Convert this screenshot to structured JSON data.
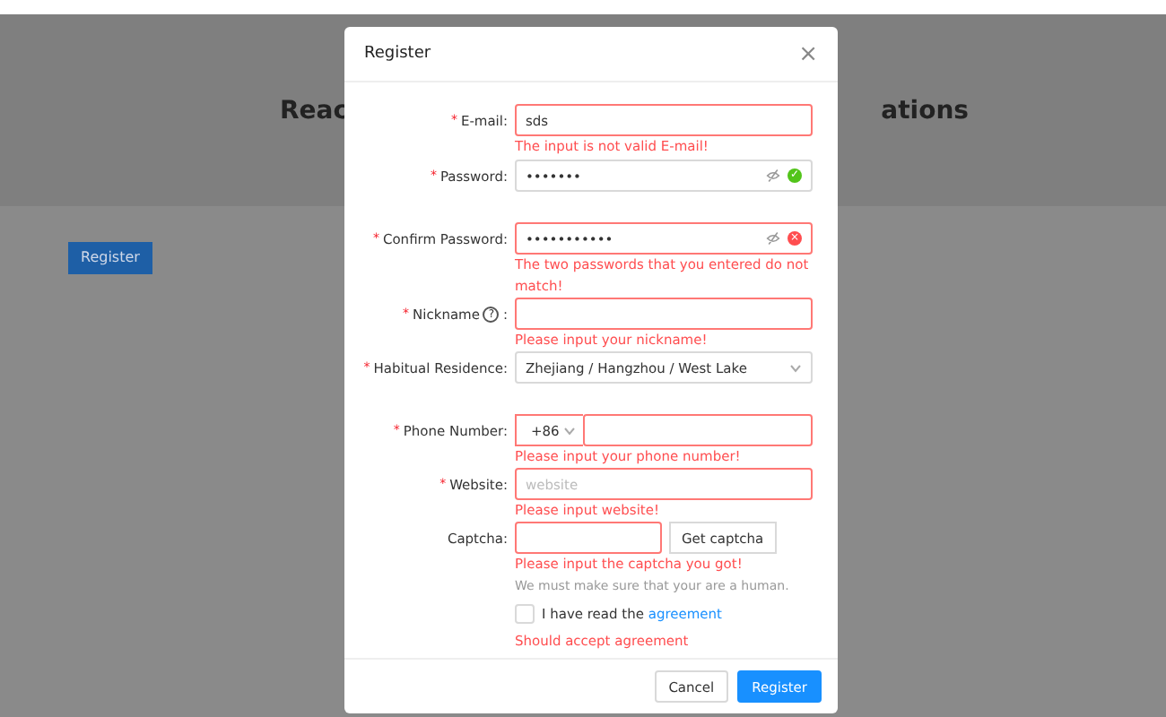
{
  "page": {
    "title_left": "Reac",
    "title_right": "ations",
    "register_button": "Register"
  },
  "modal": {
    "title": "Register",
    "close": "×",
    "fields": [
      {
        "kind": "text",
        "label": "E-mail:",
        "required_mark": "*",
        "value": "sds",
        "error": "The input is not valid E-mail!",
        "invalid": true
      },
      {
        "kind": "password",
        "label": "Password:",
        "required_mark": "*",
        "value": "•••••••",
        "invalid": false,
        "valid_mark": "✓"
      },
      {
        "kind": "password",
        "label": "Confirm Password:",
        "required_mark": "*",
        "value": "•••••••••••",
        "error": "The two passwords that you entered do not match!",
        "invalid": true,
        "invalid_mark": "×"
      },
      {
        "kind": "text",
        "label": "Nickname",
        "help_mark": "?",
        "label_end": ":",
        "required_mark": "*",
        "error": "Please input your nickname!",
        "invalid": true
      },
      {
        "kind": "select",
        "label": "Habitual Residence:",
        "required_mark": "*",
        "value": "Zhejiang / Hangzhou / West Lake",
        "invalid": false
      },
      {
        "kind": "phone",
        "label": "Phone Number:",
        "required_mark": "*",
        "prefix": "+86",
        "error": "Please input your phone number!",
        "invalid": true
      },
      {
        "kind": "text",
        "label": "Website:",
        "required_mark": "*",
        "placeholder": "website",
        "error": "Please input website!",
        "invalid": true
      },
      {
        "kind": "captcha",
        "label": "Captcha:",
        "button": "Get captcha",
        "error": "Please input the captcha you got!",
        "extra": "We must make sure that your are a human.",
        "invalid": true
      }
    ],
    "agreement": {
      "checked": false,
      "text": "I have read the",
      "link": "agreement",
      "error": "Should accept agreement"
    },
    "buttons": [
      {
        "label": "Cancel",
        "primary": false
      },
      {
        "label": "Register",
        "primary": true
      }
    ]
  }
}
